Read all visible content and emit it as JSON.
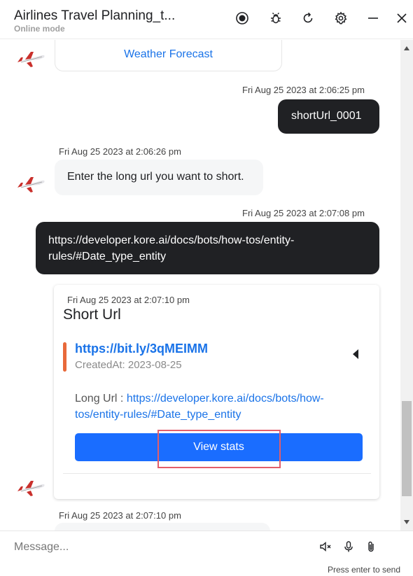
{
  "header": {
    "title": "Airlines Travel Planning_t...",
    "subtitle": "Online mode",
    "icons": [
      "record-icon",
      "bug-icon",
      "refresh-icon",
      "settings-icon",
      "minimize-icon",
      "close-icon"
    ]
  },
  "messages": {
    "weather_link": "Weather Forecast",
    "ts1": "Fri Aug 25 2023 at 2:06:25 pm",
    "user1": "shortUrl_0001",
    "ts2": "Fri Aug 25 2023 at 2:06:26 pm",
    "bot1": "Enter the long url you want to short.",
    "ts3": "Fri Aug 25 2023 at 2:07:08 pm",
    "user2_line1": "https://developer.kore.ai/docs/bots/how-tos/entity-",
    "user2_line2": "rules/#Date_type_entity",
    "ts4": "Fri Aug 25 2023 at 2:07:10 pm",
    "ts5": "Fri Aug 25 2023 at 2:07:10 pm"
  },
  "short_url_card": {
    "title": "Short Url",
    "short_url": "https://bit.ly/3qMEIMM",
    "created_at": "CreatedAt: 2023-08-25",
    "long_url_label": "Long Url : ",
    "long_url": "https://developer.kore.ai/docs/bots/how-tos/entity-rules/#Date_type_entity",
    "button_label": "View stats",
    "accent_color": "#e8693a",
    "button_color": "#1a6dff"
  },
  "footer": {
    "placeholder": "Message...",
    "hint": "Press enter to send",
    "icons": [
      "mute-icon",
      "microphone-icon",
      "attachment-icon"
    ]
  }
}
